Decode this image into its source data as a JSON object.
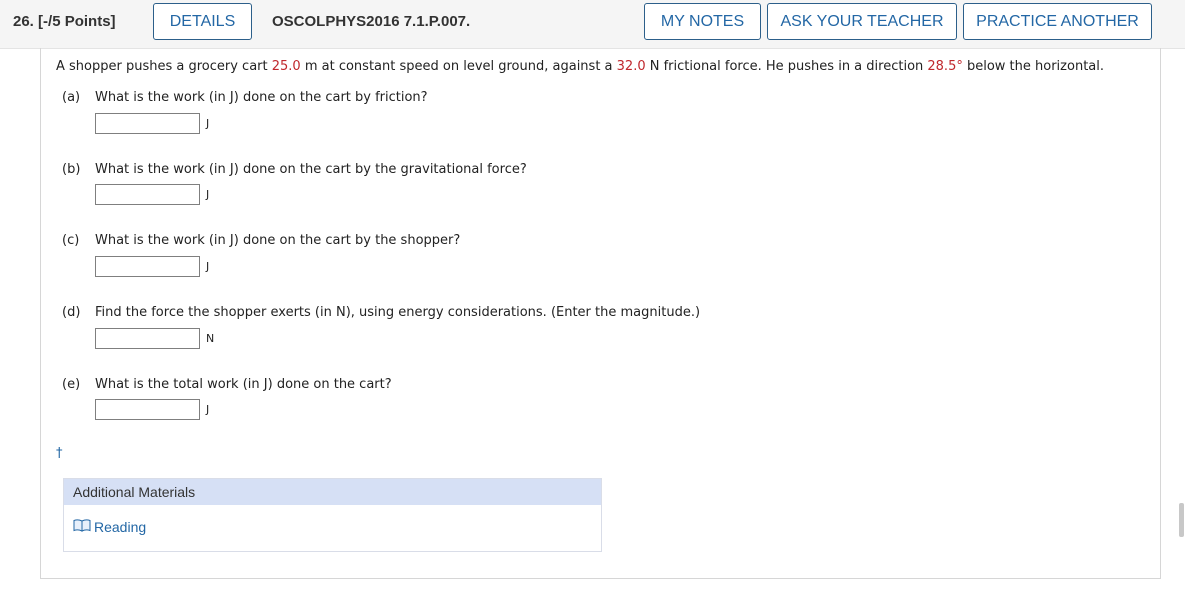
{
  "header": {
    "question_number": "26.",
    "points": "[-/5 Points]",
    "details_label": "DETAILS",
    "problem_id": "OSCOLPHYS2016 7.1.P.007.",
    "my_notes_label": "MY NOTES",
    "ask_teacher_label": "ASK YOUR TEACHER",
    "practice_another_label": "PRACTICE ANOTHER"
  },
  "problem": {
    "text_1": "A shopper pushes a grocery cart ",
    "distance": "25.0",
    "text_2": " m at constant speed on level ground, against a ",
    "friction": "32.0",
    "text_3": " N frictional force. He pushes in a direction ",
    "angle": "28.5°",
    "text_4": " below the horizontal."
  },
  "parts": [
    {
      "letter": "(a)",
      "question": "What is the work (in J) done on the cart by friction?",
      "value": "",
      "unit": "J"
    },
    {
      "letter": "(b)",
      "question": "What is the work (in J) done on the cart by the gravitational force?",
      "value": "",
      "unit": "J"
    },
    {
      "letter": "(c)",
      "question": "What is the work (in J) done on the cart by the shopper?",
      "value": "",
      "unit": "J"
    },
    {
      "letter": "(d)",
      "question": "Find the force the shopper exerts (in N), using energy considerations. (Enter the magnitude.)",
      "value": "",
      "unit": "N"
    },
    {
      "letter": "(e)",
      "question": "What is the total work (in J) done on the cart?",
      "value": "",
      "unit": "J"
    }
  ],
  "dagger": "†",
  "materials": {
    "title": "Additional Materials",
    "reading_label": "Reading",
    "reading_icon": "book-icon"
  },
  "colors": {
    "accent": "#2367a5",
    "highlight": "#c0282d",
    "materials_header": "#d6e0f5"
  }
}
